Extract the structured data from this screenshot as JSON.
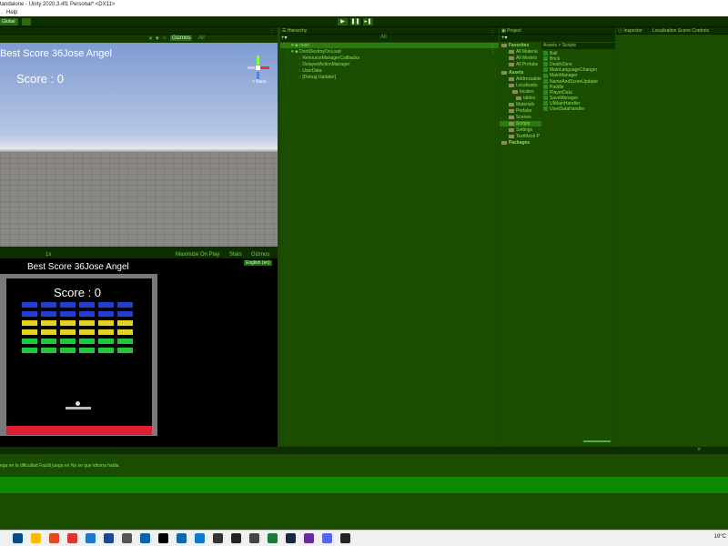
{
  "window": {
    "title": "tandalone - Unity 2020.3.4f1 Personal* <DX11>"
  },
  "menu": {
    "items": [
      "Help"
    ]
  },
  "toolbar": {
    "global_label": "Global",
    "collab_label": ""
  },
  "scene": {
    "gizmos_label": "Gizmos",
    "search_placeholder": "All",
    "best_score": "Best Score 36Jose Angel",
    "score": "Score : 0",
    "view_label": "< Back"
  },
  "game": {
    "scale_label": "1x",
    "maximize_label": "Maximize On Play",
    "stats_label": "Stats",
    "gizmos_label": "Gizmos",
    "language": "English (en)",
    "best_score": "Best Score 36Jose Angel",
    "score": "Score : 0",
    "brick_rows": [
      "#1f3fd4",
      "#1f3fd4",
      "#e6d21e",
      "#e6d21e",
      "#1ec83c",
      "#1ec83c"
    ],
    "brick_columns": 6,
    "bottom_bar_color": "#e02030"
  },
  "hierarchy": {
    "title": "Hierarchy",
    "search_placeholder": "All",
    "scenes": [
      {
        "label": "main",
        "indent": 0
      },
      {
        "label": "DontDestroyOnLoad",
        "indent": 0
      },
      {
        "label": "ResourceManagerCallbacks",
        "indent": 1
      },
      {
        "label": "DelayedActionManager",
        "indent": 1
      },
      {
        "label": "UserData",
        "indent": 1
      },
      {
        "label": "[Debug Updater]",
        "indent": 1
      }
    ]
  },
  "project": {
    "title": "Project",
    "favorites": "Favorites",
    "favorites_items": [
      "All Materia",
      "All Models",
      "All Prefabs"
    ],
    "assets": "Assets",
    "asset_folders": [
      {
        "label": "Addressable",
        "indent": 1
      },
      {
        "label": "Localizatio",
        "indent": 1
      },
      {
        "label": "locales",
        "indent": 2
      },
      {
        "label": "tables",
        "indent": 3
      },
      {
        "label": "Materials",
        "indent": 1
      },
      {
        "label": "Prefabs",
        "indent": 1
      },
      {
        "label": "Scenes",
        "indent": 1
      },
      {
        "label": "Scripts",
        "indent": 1
      },
      {
        "label": "Settings",
        "indent": 1
      },
      {
        "label": "TextMesh P",
        "indent": 1
      }
    ],
    "packages": "Packages",
    "breadcrumb": "Assets > Scripts",
    "scripts": [
      "Ball",
      "Brick",
      "DeathZone",
      "MainLanguageChanger",
      "MainManager",
      "NameAndScoreUpdater",
      "Paddle",
      "PlayerData",
      "SaveManager",
      "UIMainHandler",
      "UserDataHandler"
    ]
  },
  "inspector": {
    "title": "Inspector",
    "tab2": "Localization Scene Controls"
  },
  "console": {
    "message": "ega en la dificultad Facilil juega en No se que idioma habla"
  },
  "taskbar": {
    "temperature": "19°C"
  }
}
